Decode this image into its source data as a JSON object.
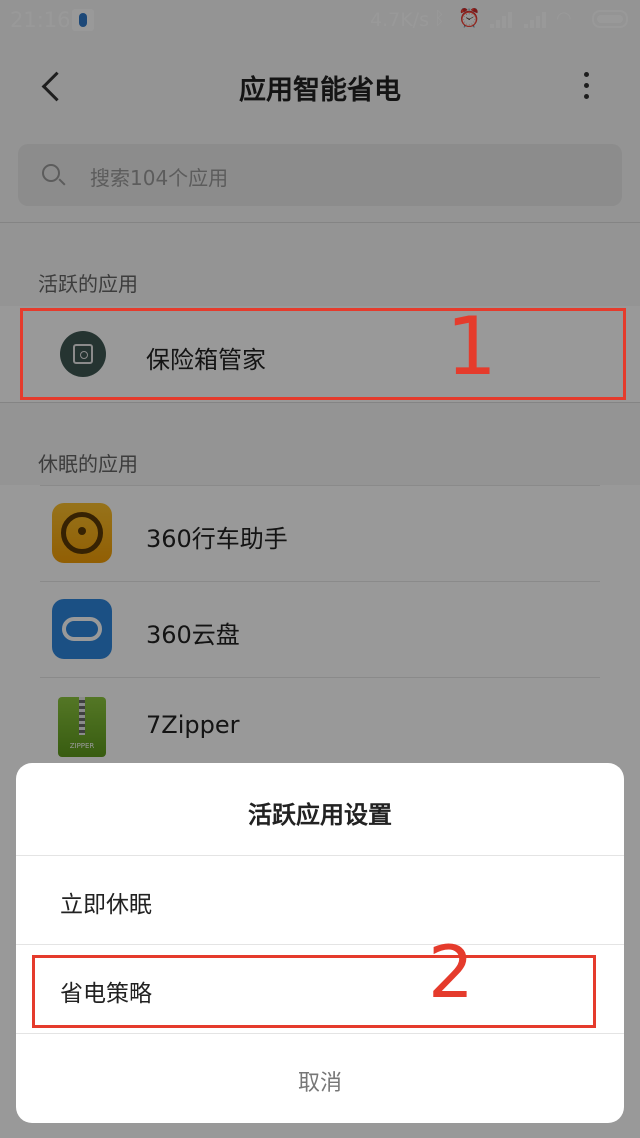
{
  "status_bar": {
    "time": "21:16",
    "net_speed": "4.7K/s"
  },
  "header": {
    "title": "应用智能省电"
  },
  "search": {
    "placeholder": "搜索104个应用"
  },
  "active_section": {
    "title": "活跃的应用",
    "apps": [
      {
        "label": "保险箱管家",
        "icon": "safe-icon"
      }
    ]
  },
  "sleeping_section": {
    "title": "休眠的应用",
    "apps": [
      {
        "label": "360行车助手",
        "icon": "steering-wheel-icon"
      },
      {
        "label": "360云盘",
        "icon": "cloud-icon"
      },
      {
        "label": "7Zipper",
        "icon": "zipper-icon"
      }
    ]
  },
  "dialog": {
    "title": "活跃应用设置",
    "options": [
      {
        "label": "立即休眠"
      },
      {
        "label": "省电策略"
      }
    ],
    "cancel_label": "取消"
  },
  "annotations": [
    "1",
    "2"
  ],
  "colors": {
    "annotation": "#e53b2c",
    "overlay": "rgba(0,0,0,0.40)"
  }
}
